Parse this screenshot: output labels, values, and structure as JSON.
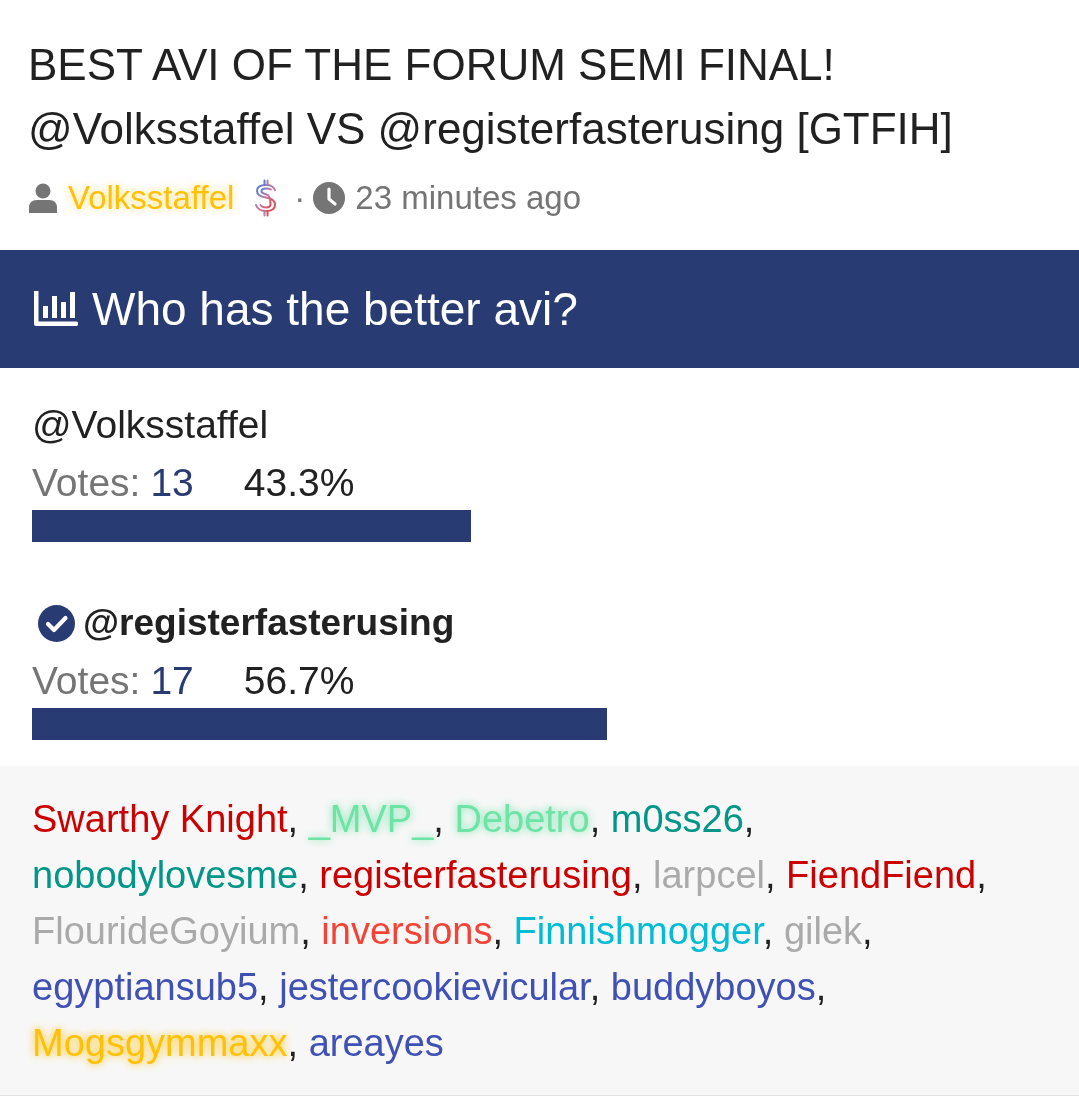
{
  "post": {
    "title": "BEST AVI OF THE FORUM SEMI FINAL! @Volksstaffel VS @registerfasterusing [GTFIH]",
    "author": "Volksstaffel",
    "separator": "·",
    "time": "23 minutes ago"
  },
  "poll": {
    "question": "Who has the better avi?",
    "options": [
      {
        "label": "@Volksstaffel",
        "votes_label": "Votes:",
        "votes": "13",
        "percent": "43.3%",
        "level": 0.433,
        "selected": false
      },
      {
        "label": "@registerfasterusing",
        "votes_label": "Votes:",
        "votes": "17",
        "percent": "56.7%",
        "level": 0.567,
        "selected": true
      }
    ]
  },
  "voters": {
    "separator": ",",
    "names": [
      {
        "name": "Swarthy Knight",
        "color": "#cc0000",
        "glow": false
      },
      {
        "name": "_MVP_",
        "color": "#6ee3a6",
        "glow": true
      },
      {
        "name": "Debetro",
        "color": "#6ee3a6",
        "glow": true
      },
      {
        "name": "m0ss26",
        "color": "#009688",
        "glow": false
      },
      {
        "name": "nobodylovesme",
        "color": "#009688",
        "glow": false
      },
      {
        "name": "registerfasterusing",
        "color": "#cc0000",
        "glow": false
      },
      {
        "name": "larpcel",
        "color": "#aaaaaa",
        "glow": false
      },
      {
        "name": "FiendFiend",
        "color": "#cc0000",
        "glow": false
      },
      {
        "name": "FlourideGoyium",
        "color": "#aaaaaa",
        "glow": false
      },
      {
        "name": "inversions",
        "color": "#f44336",
        "glow": false
      },
      {
        "name": "Finnishmogger",
        "color": "#00bcd4",
        "glow": false
      },
      {
        "name": "gilek",
        "color": "#aaaaaa",
        "glow": false
      },
      {
        "name": "egyptiansub5",
        "color": "#3f51b5",
        "glow": false
      },
      {
        "name": "jestercookievicular",
        "color": "#3f51b5",
        "glow": false
      },
      {
        "name": "buddyboyos",
        "color": "#3f51b5",
        "glow": false
      },
      {
        "name": "Mogsgymmaxx",
        "color": "#ffc107",
        "glow": true
      },
      {
        "name": "areayes",
        "color": "#3f51b5",
        "glow": false
      }
    ]
  }
}
